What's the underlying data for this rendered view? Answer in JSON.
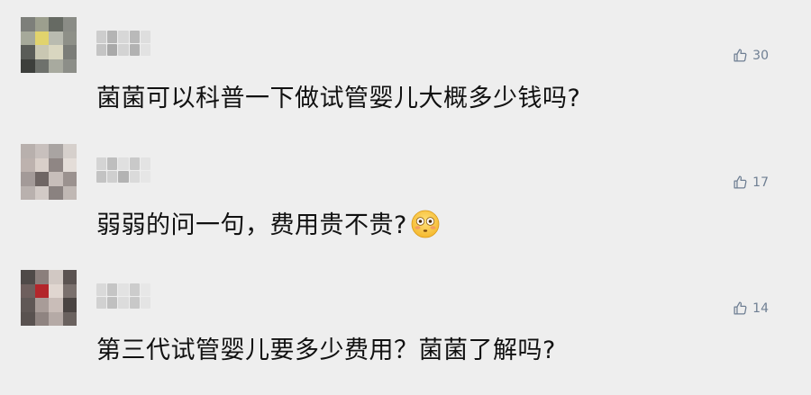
{
  "comments": [
    {
      "text": "菌菌可以科普一下做试管婴儿大概多少钱吗?",
      "likes": "30",
      "has_emoji": false,
      "avatar_colors": [
        "#7d7f7a",
        "#9c9f8e",
        "#666a63",
        "#8a8c86",
        "#a6a99a",
        "#e1d36d",
        "#b9bbb0",
        "#8e9088",
        "#5a5c58",
        "#c9c7b2",
        "#d9d6c0",
        "#7b7d78",
        "#3d3f3c",
        "#6e716c",
        "#a8aa9f",
        "#8c8e88"
      ],
      "username_colors": [
        "#c8c8c8",
        "#aaaaaa",
        "#d4d4d4",
        "#b0b0b0",
        "#dcdcdc",
        "#bdbdbd",
        "#9e9e9e",
        "#cfcfcf",
        "#a8a8a8",
        "#e0e0e0"
      ]
    },
    {
      "text": "弱弱的问一句，费用贵不贵?",
      "likes": "17",
      "has_emoji": true,
      "avatar_colors": [
        "#b8b0ad",
        "#c8c0bd",
        "#a9a4a2",
        "#d6d0cc",
        "#bdb2ae",
        "#d9cfc9",
        "#8f8684",
        "#e4ddd8",
        "#a39a98",
        "#6f6664",
        "#c7beba",
        "#9b928f",
        "#b9b1ae",
        "#d2cac6",
        "#8a8280",
        "#c0b8b4"
      ],
      "username_colors": [
        "#d0d0d0",
        "#b6b6b6",
        "#dedede",
        "#c3c3c3",
        "#e2e2e2",
        "#bcbcbc",
        "#cacaca",
        "#a9a9a9",
        "#d7d7d7",
        "#e5e5e5"
      ]
    },
    {
      "text": "第三代试管婴儿要多少费用？菌菌了解吗?",
      "likes": "14",
      "has_emoji": false,
      "avatar_colors": [
        "#4f4a48",
        "#8b7f7c",
        "#d1c8c3",
        "#5b5351",
        "#6e5f5d",
        "#b3262b",
        "#e0d6d0",
        "#7a706d",
        "#605856",
        "#a89c98",
        "#c9bdb8",
        "#4a4442",
        "#595250",
        "#8f8481",
        "#b5aaa6",
        "#6a625f"
      ],
      "username_colors": [
        "#d6d6d6",
        "#bfbfbf",
        "#e0e0e0",
        "#c7c7c7",
        "#e6e6e6",
        "#cccccc",
        "#b8b8b8",
        "#d9d9d9",
        "#c2c2c2",
        "#e3e3e3"
      ]
    }
  ],
  "like_icon": "thumbs-up-icon",
  "emoji_icon": "flushed-face-icon",
  "accent_color": "#6f7f93"
}
